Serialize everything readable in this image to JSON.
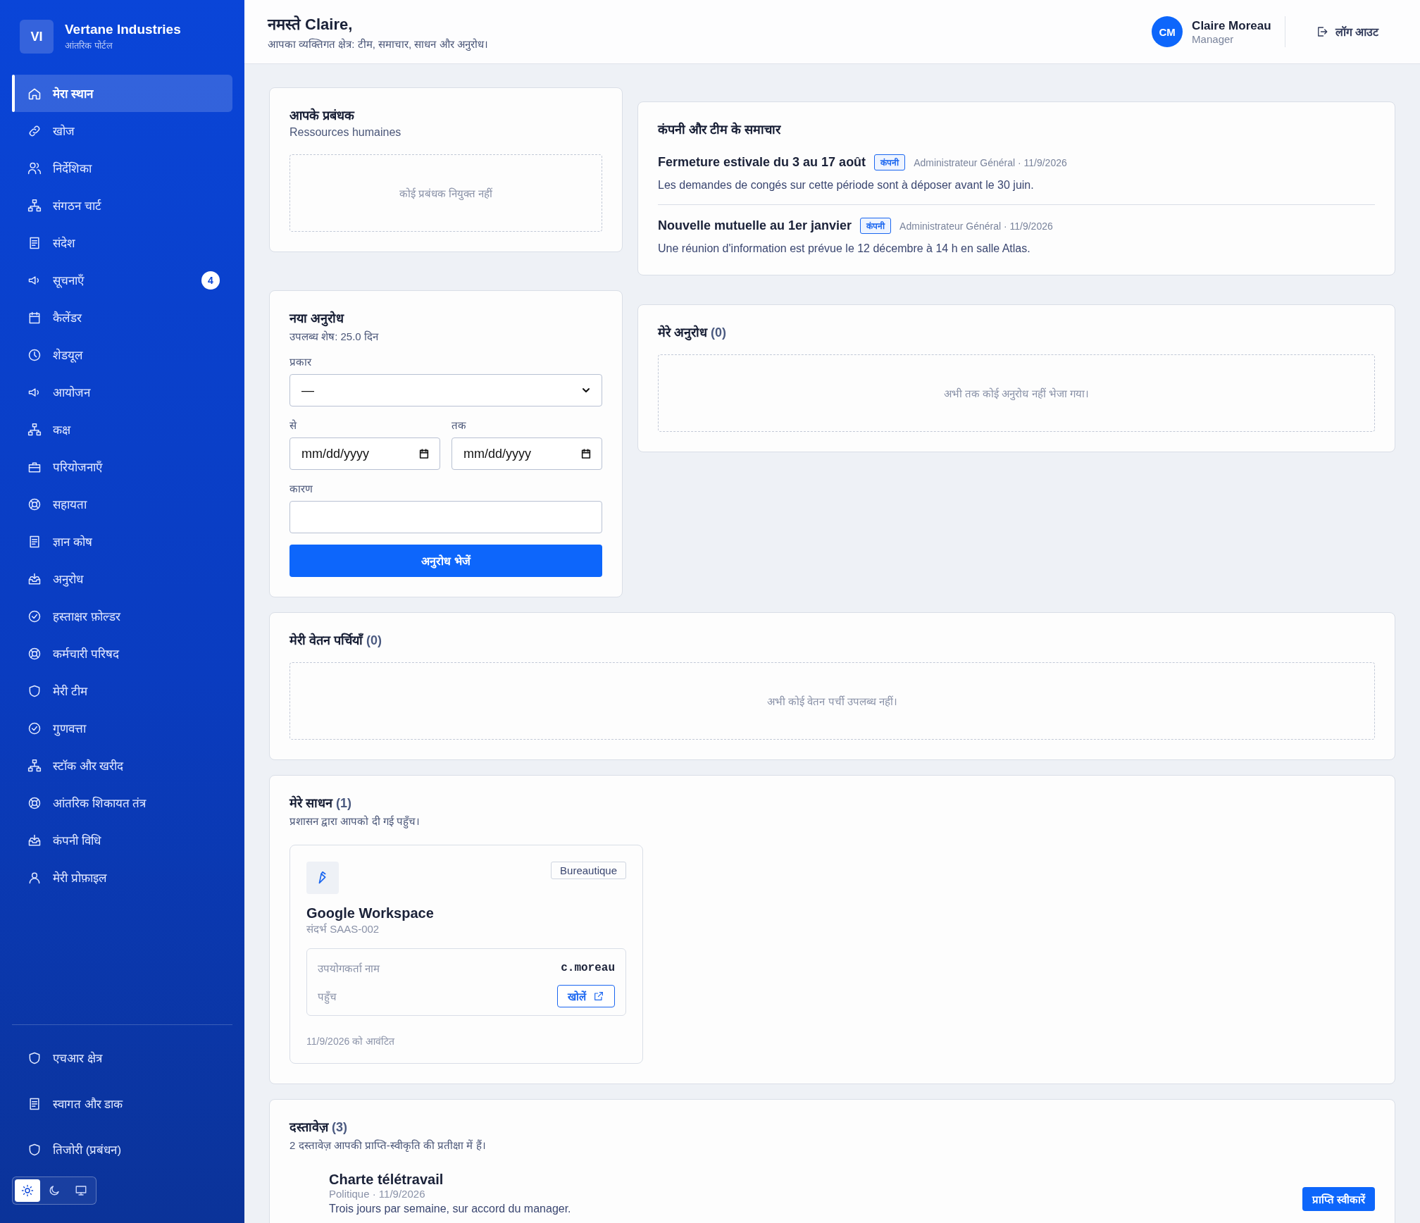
{
  "sidebar": {
    "logo": "VI",
    "company": "Vertane Industries",
    "subtitle": "आंतरिक पोर्टल",
    "items": [
      {
        "label": "मेरा स्थान",
        "selected": true
      },
      {
        "label": "खोज",
        "selected": false
      },
      {
        "label": "निर्देशिका",
        "selected": false
      },
      {
        "label": "संगठन चार्ट",
        "selected": false
      },
      {
        "label": "संदेश",
        "selected": false
      },
      {
        "label": "सूचनाएँ",
        "selected": false,
        "badge": "4"
      },
      {
        "label": "कैलेंडर",
        "selected": false
      },
      {
        "label": "शेडयूल",
        "selected": false
      },
      {
        "label": "आयोजन",
        "selected": false
      },
      {
        "label": "कक्ष",
        "selected": false
      },
      {
        "label": "परियोजनाएँ",
        "selected": false
      },
      {
        "label": "सहायता",
        "selected": false
      },
      {
        "label": "ज्ञान कोष",
        "selected": false
      },
      {
        "label": "अनुरोध",
        "selected": false
      },
      {
        "label": "हस्ताक्षर फ़ोल्डर",
        "selected": false
      },
      {
        "label": "कर्मचारी परिषद",
        "selected": false
      },
      {
        "label": "मेरी टीम",
        "selected": false
      },
      {
        "label": "गुणवत्ता",
        "selected": false
      },
      {
        "label": "स्टॉक और खरीद",
        "selected": false
      },
      {
        "label": "आंतरिक शिकायत तंत्र",
        "selected": false
      },
      {
        "label": "कंपनी विधि",
        "selected": false
      },
      {
        "label": "मेरी प्रोफ़ाइल",
        "selected": false
      }
    ],
    "footer_items": [
      {
        "label": "एचआर क्षेत्र",
        "selected": false
      },
      {
        "label": "स्वागत और डाक",
        "selected": false
      },
      {
        "label": "तिजोरी (प्रबंधन)",
        "selected": false
      }
    ],
    "theme_options": [
      {
        "selected": true
      },
      {
        "selected": false
      },
      {
        "selected": false
      }
    ]
  },
  "header": {
    "greeting": "नमस्ते Claire,",
    "subtitle": "आपका व्यक्तिगत क्षेत्र: टीम, समाचार, साधन और अनुरोध।",
    "user": {
      "initials": "CM",
      "name": "Claire Moreau",
      "role": "Manager"
    },
    "logout": "लॉग आउट"
  },
  "manager_card": {
    "title": "आपके प्रबंधक",
    "subtitle": "Ressources humaines",
    "empty": "कोई प्रबंधक नियुक्त नहीं"
  },
  "news": {
    "title": "कंपनी और टीम के समाचार",
    "items": [
      {
        "title": "Fermeture estivale du 3 au 17 août",
        "tag": "कंपनी",
        "meta": "Administrateur Général · 11/9/2026",
        "body": "Les demandes de congés sur cette période sont à déposer avant le 30 juin."
      },
      {
        "title": "Nouvelle mutuelle au 1er janvier",
        "tag": "कंपनी",
        "meta": "Administrateur Général · 11/9/2026",
        "body": "Une réunion d'information est prévue le 12 décembre à 14 h en salle Atlas."
      }
    ]
  },
  "new_request": {
    "title": "नया अनुरोध",
    "balance": "उपलब्ध शेष: 25.0 दिन",
    "type_label": "प्रकार",
    "type_value": "—",
    "from_label": "से",
    "from_value": "mm/dd/yyyy",
    "to_label": "तक",
    "to_value": "mm/dd/yyyy",
    "reason_label": "कारण",
    "submit": "अनुरोध भेजें"
  },
  "my_requests": {
    "title": "मेरे अनुरोध",
    "count": "(0)",
    "empty": "अभी तक कोई अनुरोध नहीं भेजा गया।"
  },
  "payslips": {
    "title": "मेरी वेतन पर्चियाँ",
    "count": "(0)",
    "empty": "अभी कोई वेतन पर्ची उपलब्ध नहीं।"
  },
  "resources": {
    "title": "मेरे साधन",
    "count": "(1)",
    "subtitle": "प्रशासन द्वारा आपको दी गई पहुँच।",
    "items": [
      {
        "tag": "Bureautique",
        "name": "Google Workspace",
        "ref": "संदर्भ SAAS-002",
        "username_label": "उपयोगकर्ता नाम",
        "username": "c.moreau",
        "access_label": "पहुँच",
        "open": "खोलें",
        "assigned": "11/9/2026 को आवंटित"
      }
    ]
  },
  "documents": {
    "title": "दस्तावेज़",
    "count": "(3)",
    "subtitle": "2 दस्तावेज़ आपकी प्राप्ति-स्वीकृति की प्रतीक्षा में हैं।",
    "items": [
      {
        "title": "Charte télétravail",
        "meta": "Politique · 11/9/2026",
        "body": "Trois jours par semaine, sur accord du manager.",
        "action": "प्राप्ति स्वीकारें"
      }
    ]
  }
}
